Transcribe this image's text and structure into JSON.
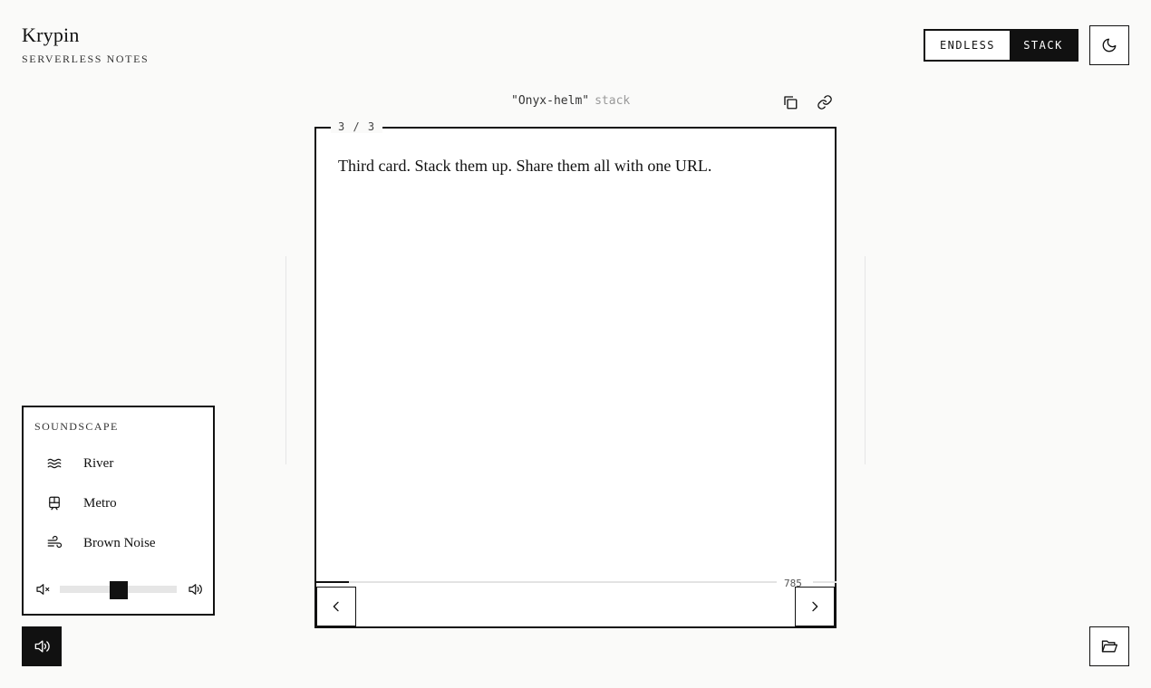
{
  "brand": {
    "title": "Krypin",
    "subtitle": "SERVERLESS NOTES"
  },
  "mode_toggle": {
    "options": [
      "ENDLESS",
      "STACK"
    ],
    "selected": "STACK"
  },
  "theme_button": {
    "icon": "moon-icon"
  },
  "stack": {
    "name": "\"Onyx-helm\"",
    "suffix": "stack",
    "copy_icon": "copy-icon",
    "link_icon": "link-icon"
  },
  "card": {
    "counter": "3 / 3",
    "text": "Third card. Stack them up. Share them all with one URL.",
    "char_count": "785",
    "progress": 0.07,
    "prev_icon": "chevron-left-icon",
    "next_icon": "chevron-right-icon"
  },
  "soundscape": {
    "heading": "SOUNDSCAPE",
    "items": [
      {
        "label": "River",
        "icon": "waves-icon"
      },
      {
        "label": "Metro",
        "icon": "train-icon"
      },
      {
        "label": "Brown Noise",
        "icon": "wind-icon"
      }
    ],
    "volume": 0.5,
    "mute_icon": "volume-mute-icon",
    "max_icon": "volume-up-icon"
  },
  "sound_toggle": {
    "icon": "volume-up-icon"
  },
  "folder_button": {
    "icon": "folder-open-icon"
  },
  "colors": {
    "ink": "#111111",
    "background": "#fafaf9",
    "muted": "#999999"
  }
}
